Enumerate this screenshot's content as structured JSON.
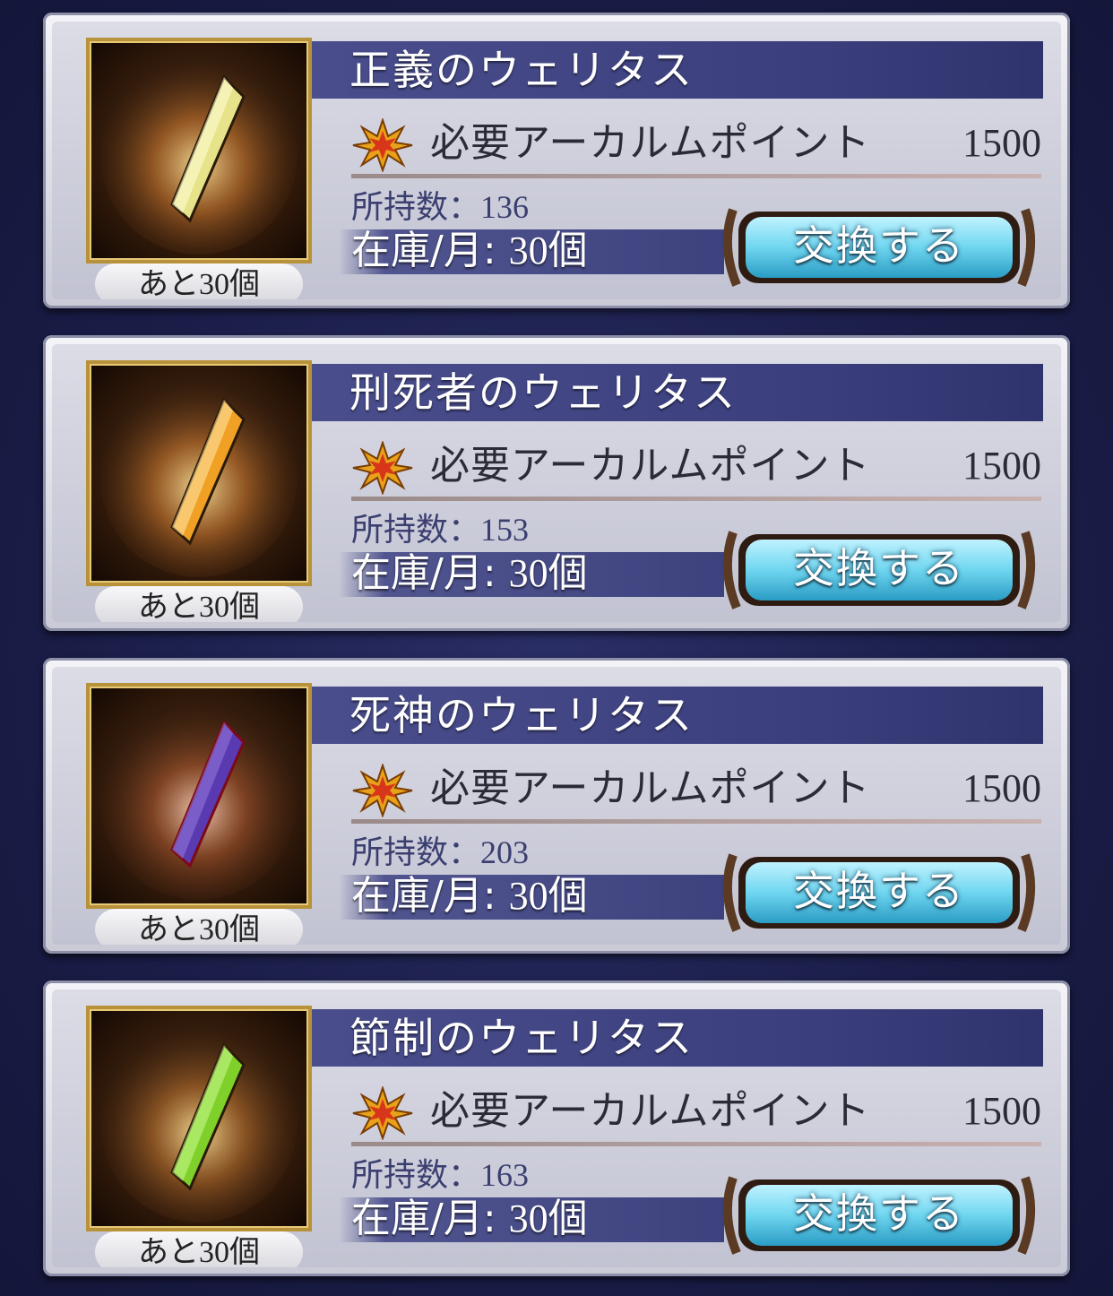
{
  "items": [
    {
      "name": "正義のウェリタス",
      "cost_label": "必要アーカルムポイント",
      "cost_value": "1500",
      "owned_label": "所持数：",
      "owned_value": "136",
      "stock_label": "在庫/月: ",
      "stock_value": "30個",
      "remain_label": "あと",
      "remain_value": "30個",
      "button_label": "交換する",
      "crystal_color": "#e6e38a"
    },
    {
      "name": "刑死者のウェリタス",
      "cost_label": "必要アーカルムポイント",
      "cost_value": "1500",
      "owned_label": "所持数：",
      "owned_value": "153",
      "stock_label": "在庫/月: ",
      "stock_value": "30個",
      "remain_label": "あと",
      "remain_value": "30個",
      "button_label": "交換する",
      "crystal_color": "#f0a024"
    },
    {
      "name": "死神のウェリタス",
      "cost_label": "必要アーカルムポイント",
      "cost_value": "1500",
      "owned_label": "所持数：",
      "owned_value": "203",
      "stock_label": "在庫/月: ",
      "stock_value": "30個",
      "remain_label": "あと",
      "remain_value": "30個",
      "button_label": "交換する",
      "crystal_color": "#5a3ab0"
    },
    {
      "name": "節制のウェリタス",
      "cost_label": "必要アーカルムポイント",
      "cost_value": "1500",
      "owned_label": "所持数：",
      "owned_value": "163",
      "stock_label": "在庫/月: ",
      "stock_value": "30個",
      "remain_label": "あと",
      "remain_value": "30個",
      "button_label": "交換する",
      "crystal_color": "#7fd02a"
    }
  ],
  "icons": {
    "point": "arcarum-point-star-icon",
    "item": "veritas-crystal-icon"
  },
  "colors": {
    "title_band": "#3a3e7c",
    "button_glow": "#6fd6f0",
    "frame_gold": "#b8923a"
  }
}
